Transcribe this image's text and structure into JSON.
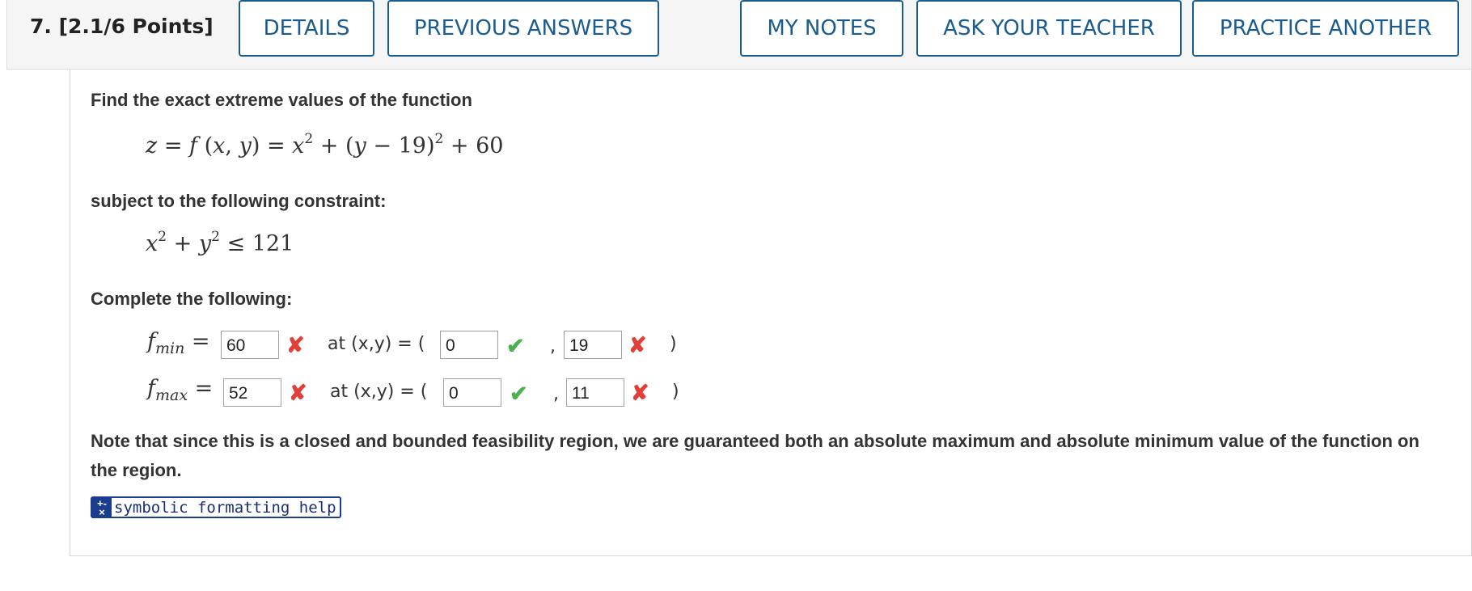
{
  "header": {
    "question_label": "7.  [2.1/6 Points]",
    "buttons": {
      "details": "DETAILS",
      "previous_answers": "PREVIOUS ANSWERS",
      "my_notes": "MY NOTES",
      "ask_teacher": "ASK YOUR TEACHER",
      "practice_another": "PRACTICE ANOTHER"
    }
  },
  "problem": {
    "intro": "Find the exact extreme values of the function",
    "constraint_intro": "subject to the following constraint:",
    "complete_intro": "Complete the following:",
    "note": "Note that since this is a closed and bounded feasibility region, we are guaranteed both an absolute maximum and absolute minimum value of the function on the region."
  },
  "answers": {
    "at_label": "at (x,y) = (",
    "comma": ",",
    "close": ")",
    "min": {
      "f": "60",
      "x": "0",
      "y": "19",
      "f_status": "incorrect",
      "x_status": "correct",
      "y_status": "incorrect"
    },
    "max": {
      "f": "52",
      "x": "0",
      "y": "11",
      "f_status": "incorrect",
      "x_status": "correct",
      "y_status": "incorrect"
    }
  },
  "help_link": {
    "label": "symbolic formatting help",
    "icon": "plus-minus-times-icon"
  },
  "colors": {
    "accent": "#1a5c8f",
    "wrong": "#e0403a",
    "right": "#4caf50"
  }
}
